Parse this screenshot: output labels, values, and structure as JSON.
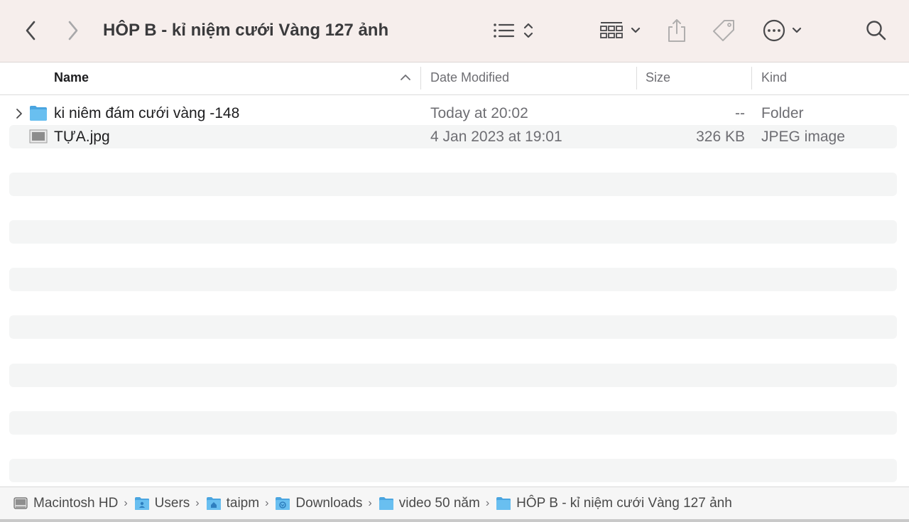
{
  "window": {
    "title": "HÔP B - kỉ niệm cưới Vàng 127 ảnh"
  },
  "toolbar": {
    "back_icon": "chevron-left-icon",
    "forward_icon": "chevron-right-icon",
    "view_icon": "list-view-icon",
    "group_icon": "grid-group-icon",
    "share_icon": "share-icon",
    "tag_icon": "tag-icon",
    "more_icon": "ellipsis-circle-icon",
    "search_icon": "search-icon"
  },
  "columns": {
    "name": "Name",
    "date": "Date Modified",
    "size": "Size",
    "kind": "Kind"
  },
  "files": [
    {
      "name": "ki niêm đám cưới vàng -148",
      "date": "Today at 20:02",
      "size": "--",
      "kind": "Folder",
      "icon": "folder-icon"
    },
    {
      "name": "TỰA.jpg",
      "date": "4 Jan 2023 at 19:01",
      "size": "326 KB",
      "kind": "JPEG image",
      "icon": "jpeg-file-icon"
    }
  ],
  "pathbar": [
    {
      "label": "Macintosh HD",
      "icon": "hard-drive-icon"
    },
    {
      "label": "Users",
      "icon": "users-folder-icon"
    },
    {
      "label": "taipm",
      "icon": "home-folder-icon"
    },
    {
      "label": "Downloads",
      "icon": "downloads-folder-icon"
    },
    {
      "label": "video 50 năm",
      "icon": "folder-icon"
    },
    {
      "label": "HÔP B - kỉ niệm cưới Vàng 127 ảnh",
      "icon": "folder-icon"
    }
  ],
  "colors": {
    "toolbar_bg": "#f6eeec",
    "folder_blue": "#5ab4ec",
    "row_alt": "#f4f5f5"
  }
}
